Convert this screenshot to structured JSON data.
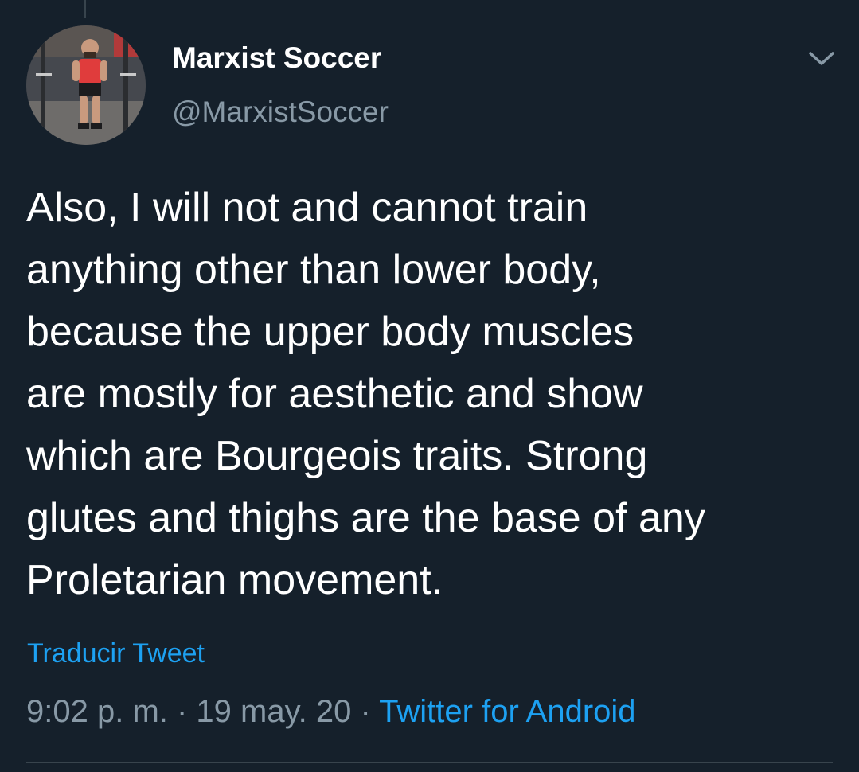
{
  "author": {
    "display_name": "Marxist Soccer",
    "handle": "@MarxistSoccer",
    "avatar_icon": "gym-photo-avatar"
  },
  "menu": {
    "icon": "chevron-down-icon"
  },
  "tweet": {
    "text": "Also, I will not and cannot train\nanything other than lower body,\nbecause the upper body muscles\nare mostly for aesthetic and show\nwhich are Bourgeois traits. Strong\nglutes and thighs are the base of any\nProletarian movement."
  },
  "translate_label": "Traducir Tweet",
  "meta": {
    "time": "9:02 p. m.",
    "separator": " · ",
    "date": "19 may. 20",
    "source": "Twitter for Android"
  },
  "colors": {
    "background": "#15202b",
    "text": "#ffffff",
    "secondary_text": "#8899a6",
    "accent": "#1da1f2",
    "divider": "#38444d"
  }
}
